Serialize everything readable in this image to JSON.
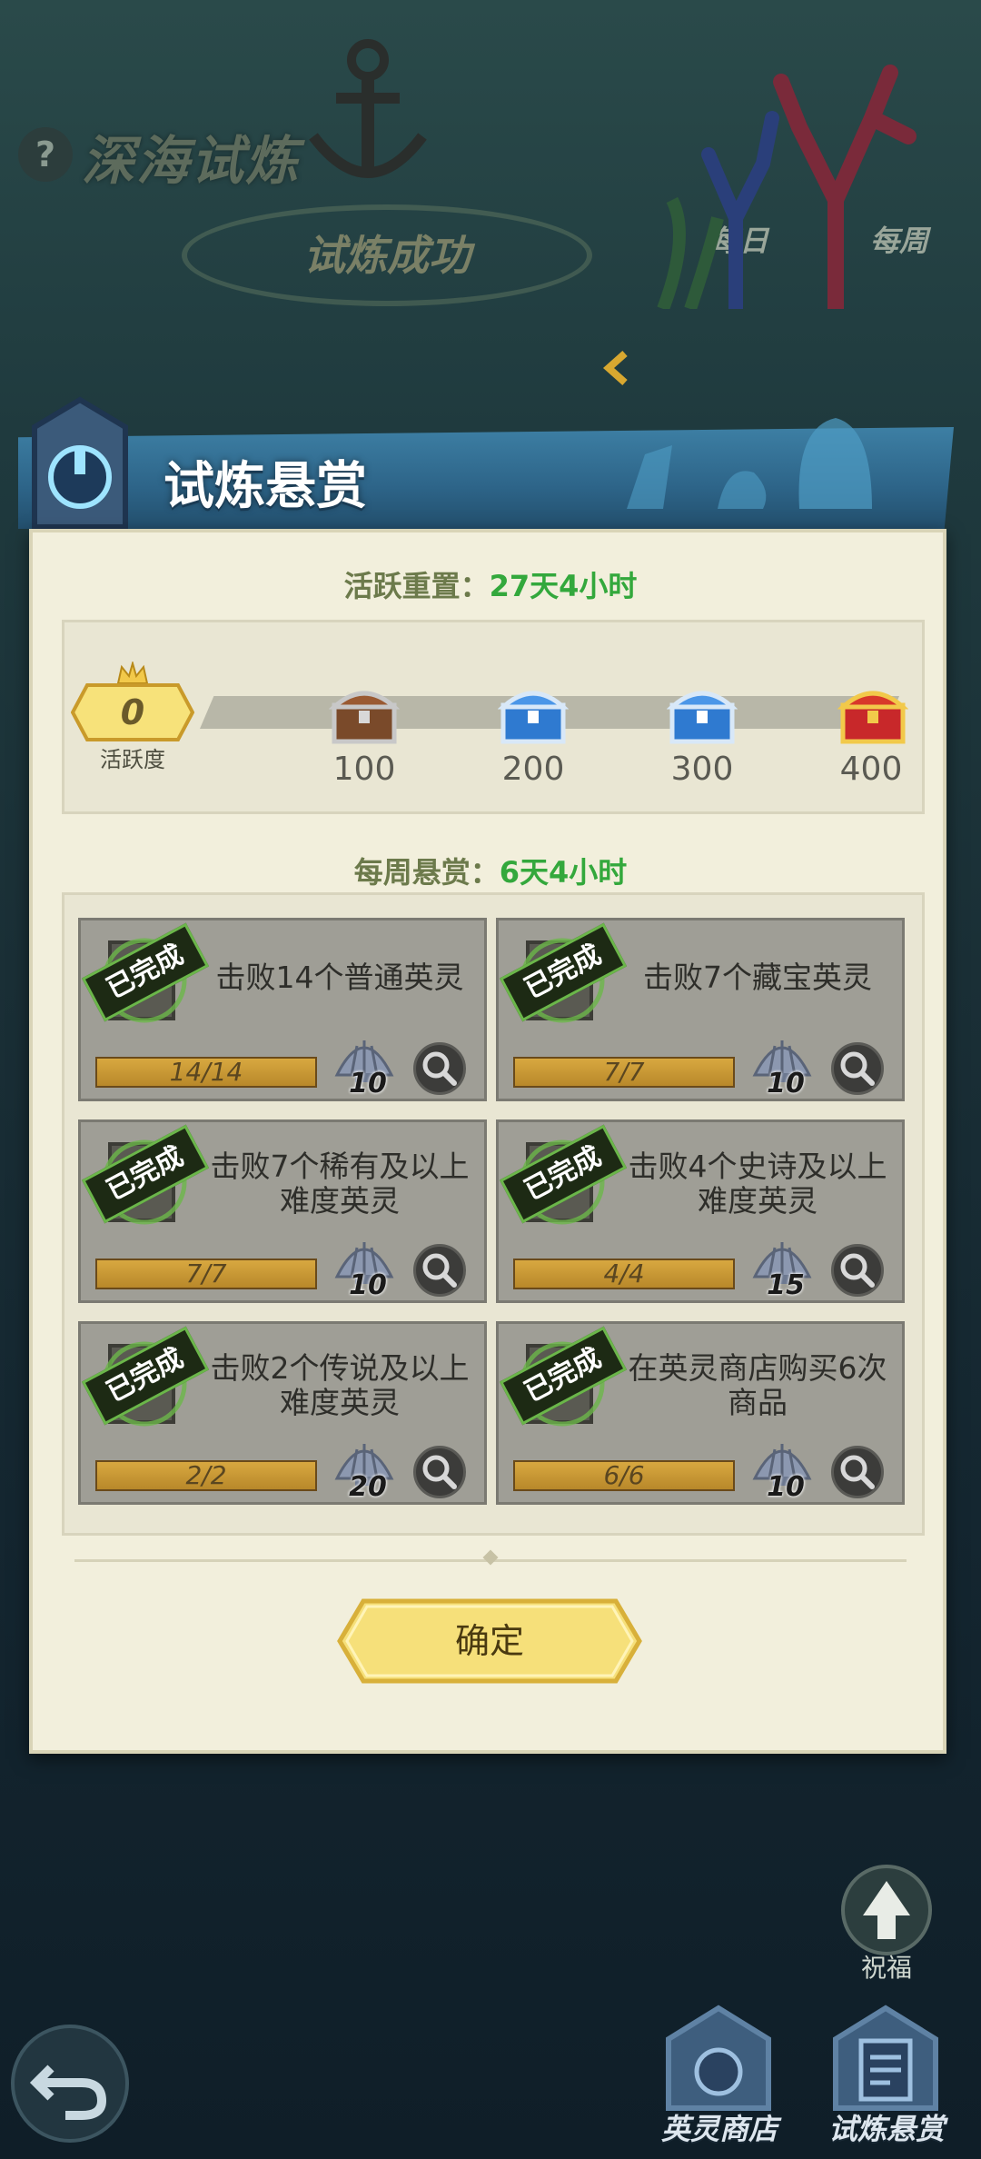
{
  "background": {
    "title": "深海试炼",
    "help_glyph": "?",
    "status": "试炼成功",
    "tabs": [
      "每日",
      "每周"
    ]
  },
  "panel": {
    "title": "试炼悬赏",
    "reset_label": "活跃重置：",
    "reset_value": "27天4小时",
    "activity": {
      "value": "0",
      "label": "活跃度",
      "progress_fraction": 0,
      "milestones": [
        {
          "value": "100",
          "chest": "wood-chest-icon"
        },
        {
          "value": "200",
          "chest": "blue-chest-icon"
        },
        {
          "value": "300",
          "chest": "blue-chest-icon"
        },
        {
          "value": "400",
          "chest": "gold-chest-icon"
        }
      ]
    },
    "weekly_label": "每周悬赏：",
    "weekly_value": "6天4小时",
    "tasks": [
      {
        "title_1": "击败14个普通英灵",
        "title_2": "",
        "badge": "已完成",
        "progress": "14/14",
        "reward": "10"
      },
      {
        "title_1": "击败7个藏宝英灵",
        "title_2": "",
        "badge": "已完成",
        "progress": "7/7",
        "reward": "10"
      },
      {
        "title_1": "击败7个稀有及以上",
        "title_2": "难度英灵",
        "badge": "已完成",
        "progress": "7/7",
        "reward": "10"
      },
      {
        "title_1": "击败4个史诗及以上",
        "title_2": "难度英灵",
        "badge": "已完成",
        "progress": "4/4",
        "reward": "15"
      },
      {
        "title_1": "击败2个传说及以上",
        "title_2": "难度英灵",
        "badge": "已完成",
        "progress": "2/2",
        "reward": "20"
      },
      {
        "title_1": "在英灵商店购买6次",
        "title_2": "商品",
        "badge": "已完成",
        "progress": "6/6",
        "reward": "10"
      }
    ],
    "confirm_label": "确定"
  },
  "bottom": {
    "bless_label": "祝福",
    "shop_label": "英灵商店",
    "bounty_label": "试炼悬赏"
  },
  "colors": {
    "header_blue": "#2d6488",
    "panel_bg": "#f2efdc",
    "highlight_green": "#33a83c",
    "card_gray": "#9f9e96",
    "badge_green": "#6bb64a"
  }
}
